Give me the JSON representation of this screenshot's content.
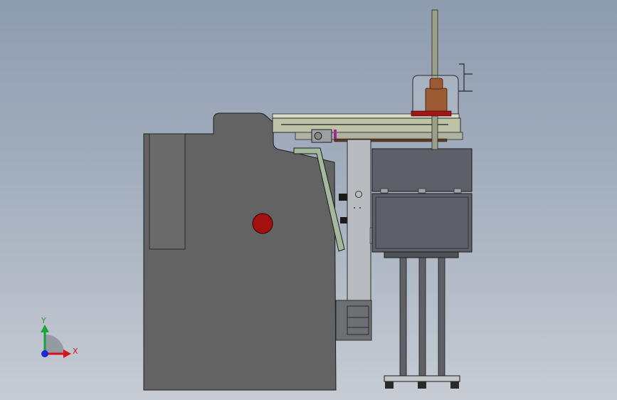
{
  "viewport": {
    "triad": {
      "x_label": "X",
      "y_label": "Y",
      "x_color": "#d8121a",
      "y_color": "#1aa33a",
      "z_color": "#1a2bd6"
    }
  },
  "colors": {
    "frame_body": "#636363",
    "panel_inset": "#6a6a6a",
    "gantry_rail": "#bfc3a6",
    "bracket_green": "#a3b89c",
    "column": "#b8bcc0",
    "cabinet": "#5d6068",
    "stand_leg": "#5e6268",
    "red_button": "#a41010",
    "bottle": "#9b5a32",
    "outline": "#1d1d1d"
  }
}
